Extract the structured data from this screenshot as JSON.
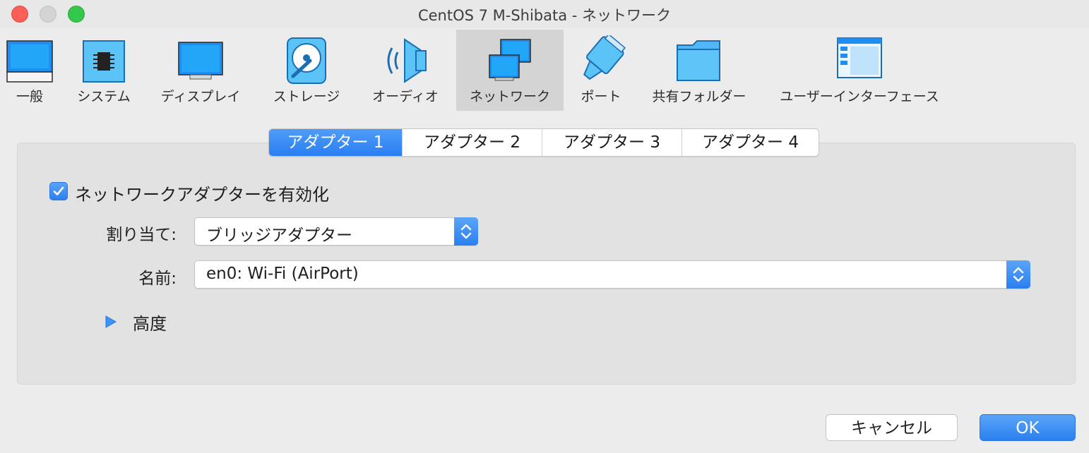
{
  "window": {
    "title": "CentOS 7 M-Shibata - ネットワーク"
  },
  "toolbar": {
    "items": [
      {
        "label": "一般",
        "icon": "general-icon"
      },
      {
        "label": "システム",
        "icon": "system-chip-icon"
      },
      {
        "label": "ディスプレイ",
        "icon": "display-icon"
      },
      {
        "label": "ストレージ",
        "icon": "storage-disk-icon"
      },
      {
        "label": "オーディオ",
        "icon": "audio-speaker-icon"
      },
      {
        "label": "ネットワーク",
        "icon": "network-icon",
        "active": true
      },
      {
        "label": "ポート",
        "icon": "port-connector-icon"
      },
      {
        "label": "共有フォルダー",
        "icon": "shared-folder-icon"
      },
      {
        "label": "ユーザーインターフェース",
        "icon": "user-interface-icon"
      }
    ]
  },
  "tabs": [
    {
      "label": "アダプター 1",
      "active": true
    },
    {
      "label": "アダプター 2"
    },
    {
      "label": "アダプター 3"
    },
    {
      "label": "アダプター 4"
    }
  ],
  "adapter": {
    "enable_label": "ネットワークアダプターを有効化",
    "enabled": true,
    "attached_label": "割り当て:",
    "attached_value": "ブリッジアダプター",
    "name_label": "名前:",
    "name_value": "en0: Wi-Fi (AirPort)",
    "advanced_label": "高度"
  },
  "buttons": {
    "cancel": "キャンセル",
    "ok": "OK"
  },
  "colors": {
    "accent": "#2b7ff0",
    "close": "#fc5f57",
    "zoom": "#34c84a"
  }
}
